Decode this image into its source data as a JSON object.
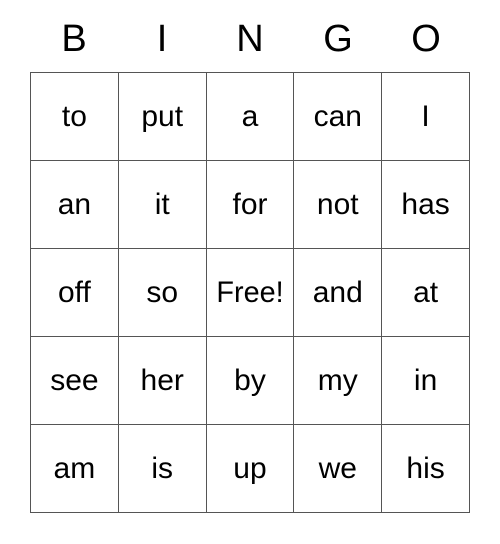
{
  "card": {
    "title_letters": [
      "B",
      "I",
      "N",
      "G",
      "O"
    ],
    "free_space_label": "Free!",
    "colors": {
      "text": "#000000",
      "border": "#555555",
      "background": "#ffffff"
    },
    "rows": [
      [
        "to",
        "put",
        "a",
        "can",
        "I"
      ],
      [
        "an",
        "it",
        "for",
        "not",
        "has"
      ],
      [
        "off",
        "so",
        "Free!",
        "and",
        "at"
      ],
      [
        "see",
        "her",
        "by",
        "my",
        "in"
      ],
      [
        "am",
        "is",
        "up",
        "we",
        "his"
      ]
    ]
  }
}
